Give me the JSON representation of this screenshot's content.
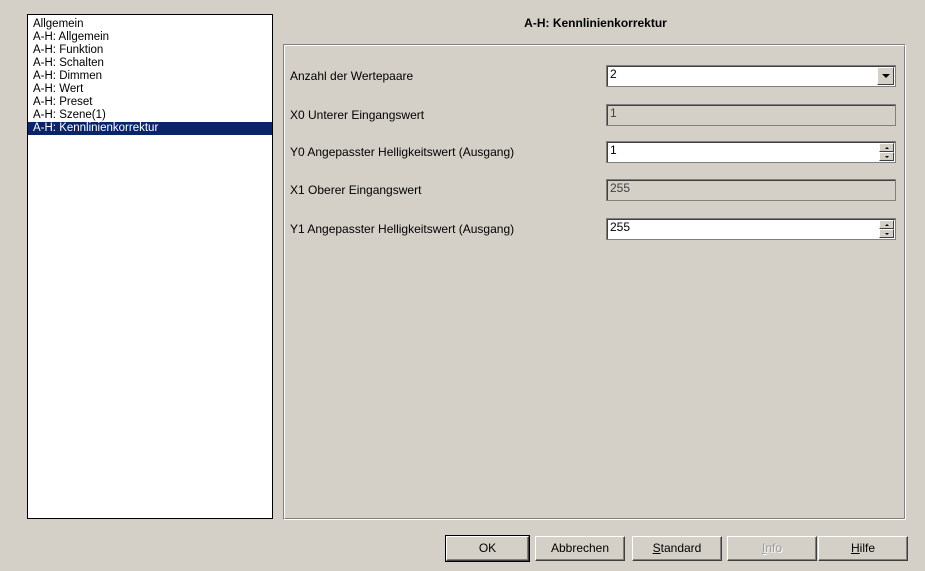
{
  "nav": {
    "items": [
      {
        "label": "Allgemein"
      },
      {
        "label": "A-H: Allgemein"
      },
      {
        "label": "A-H: Funktion"
      },
      {
        "label": "A-H: Schalten"
      },
      {
        "label": "A-H: Dimmen"
      },
      {
        "label": "A-H: Wert"
      },
      {
        "label": "A-H: Preset"
      },
      {
        "label": "A-H: Szene(1)"
      },
      {
        "label": "A-H: Kennlinienkorrektur"
      }
    ],
    "selected_index": 8
  },
  "page": {
    "title": "A-H: Kennlinienkorrektur"
  },
  "params": [
    {
      "label": "Anzahl der Wertepaare",
      "value": "2",
      "control": "dropdown"
    },
    {
      "label": "X0 Unterer Eingangswert",
      "value": "1",
      "control": "readonly"
    },
    {
      "label": "Y0 Angepasster Helligkeitswert (Ausgang)",
      "value": "1",
      "control": "spinner"
    },
    {
      "label": "X1 Oberer Eingangswert",
      "value": "255",
      "control": "readonly"
    },
    {
      "label": "Y1 Angepasster Helligkeitswert (Ausgang)",
      "value": "255",
      "control": "spinner"
    }
  ],
  "buttons": {
    "ok": "OK",
    "cancel": "Abbrechen",
    "standard_mnemonic": "S",
    "standard_rest": "tandard",
    "info_mnemonic": "I",
    "info_rest": "nfo",
    "help_mnemonic": "H",
    "help_rest": "ilfe"
  },
  "colors": {
    "window_bg": "#d4d0c8",
    "selection_bg": "#0a246a",
    "selection_fg": "#ffffff"
  },
  "icons": {
    "dropdown": "chevron-down-icon",
    "spin_up": "spin-up-icon",
    "spin_down": "spin-down-icon"
  }
}
